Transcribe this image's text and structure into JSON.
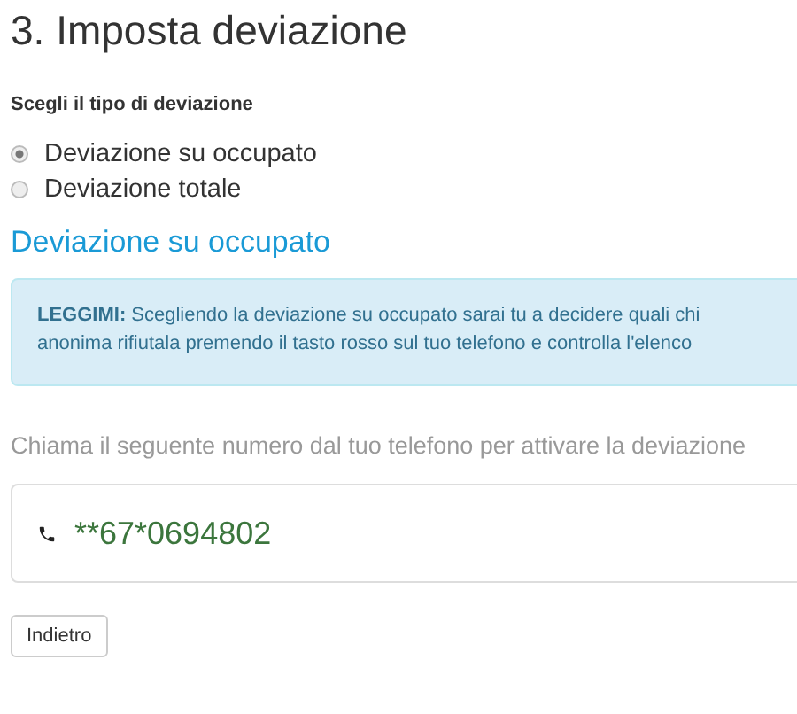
{
  "title": "3. Imposta deviazione",
  "type_label": "Scegli il tipo di deviazione",
  "options": [
    {
      "label": "Deviazione su occupato",
      "selected": true
    },
    {
      "label": "Deviazione totale",
      "selected": false
    }
  ],
  "section_title": "Deviazione su occupato",
  "alert": {
    "lines": [
      "**LEGGIMI:** Scegliendo la deviazione su occupato sarai tu a decidere quali chi",
      "anonima rifiutala premendo il tasto rosso sul tuo telefono e controlla l'elenco"
    ]
  },
  "instruction": "Chiama il seguente numero dal tuo telefono per attivare la deviazione",
  "code": "**67*0694802",
  "back_button": "Indietro"
}
